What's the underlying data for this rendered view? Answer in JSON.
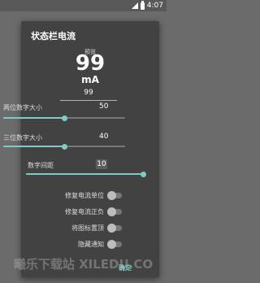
{
  "status_bar": {
    "time": "4:07"
  },
  "dialog": {
    "title": "状态栏电流",
    "preview": {
      "label": "预览",
      "value": "99",
      "unit": "mA"
    },
    "preview_input": "99",
    "two_digit": {
      "label": "两位数字大小",
      "value": "50",
      "level": 0.5
    },
    "three_digit": {
      "label": "三位数字大小",
      "value": "40",
      "level": 0.5
    },
    "spacing": {
      "label": "数字间距",
      "value": "10",
      "level": 1.0
    },
    "switches": [
      {
        "label": "修复电流单位",
        "on": false
      },
      {
        "label": "修复电流正负",
        "on": false
      },
      {
        "label": "将图标置顶",
        "on": false
      },
      {
        "label": "隐藏通知",
        "on": false
      }
    ],
    "ok_label": "确定"
  },
  "watermark": "曦乐下载站 XILEDU.CO",
  "colors": {
    "accent": "#80cbc4",
    "dialog_bg": "#424242"
  }
}
